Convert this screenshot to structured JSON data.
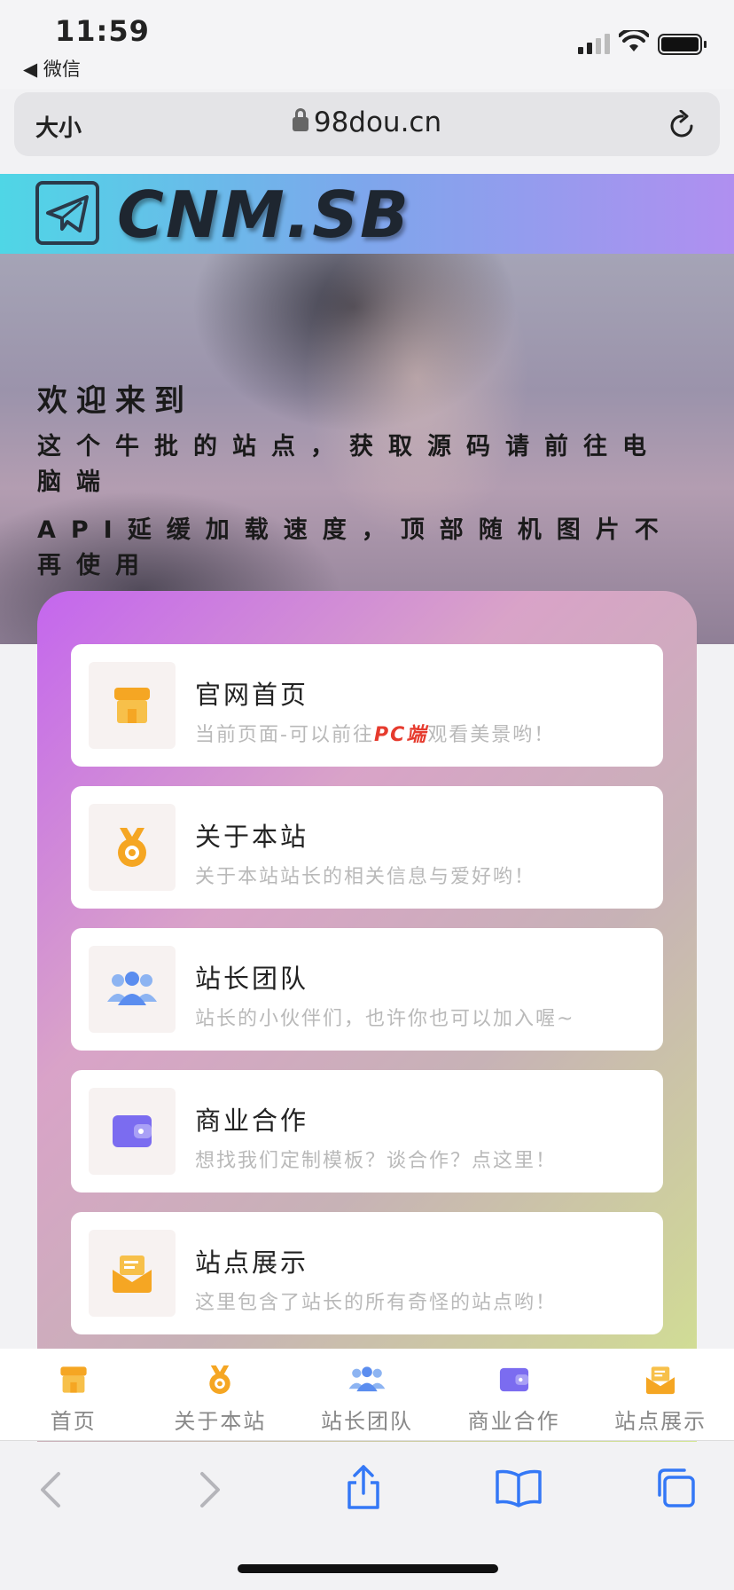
{
  "status": {
    "time": "11:59",
    "back_app": "◀ 微信"
  },
  "urlbar": {
    "text_size": "大小",
    "url": "98dou.cn"
  },
  "header": {
    "title": "CNM.SB"
  },
  "hero": {
    "title": "欢迎来到",
    "line1": "这个牛批的站点，获取源码请前往电脑端",
    "line2": "API延缓加载速度，顶部随机图片不再使用"
  },
  "cards": [
    {
      "title": "官网首页",
      "sub_before": "当前页面-可以前往",
      "sub_pc": "PC端",
      "sub_after": "观看美景哟！",
      "icon": "shop-icon"
    },
    {
      "title": "关于本站",
      "sub": "关于本站站长的相关信息与爱好哟！",
      "icon": "medal-icon"
    },
    {
      "title": "站长团队",
      "sub": "站长的小伙伴们，也许你也可以加入喔~",
      "icon": "team-icon"
    },
    {
      "title": "商业合作",
      "sub": "想找我们定制模板？谈合作？点这里！",
      "icon": "wallet-icon"
    },
    {
      "title": "站点展示",
      "sub": "这里包含了站长的所有奇怪的站点哟！",
      "icon": "mail-box-icon"
    }
  ],
  "tabs": [
    {
      "label": "首页",
      "icon": "shop-icon"
    },
    {
      "label": "关于本站",
      "icon": "medal-icon"
    },
    {
      "label": "站长团队",
      "icon": "team-icon"
    },
    {
      "label": "商业合作",
      "icon": "wallet-icon"
    },
    {
      "label": "站点展示",
      "icon": "mail-box-icon"
    }
  ],
  "colors": {
    "accent_orange": "#f5a623",
    "accent_blue": "#5b8def",
    "accent_purple": "#7b6cf0",
    "pc_red": "#e63b2e"
  }
}
